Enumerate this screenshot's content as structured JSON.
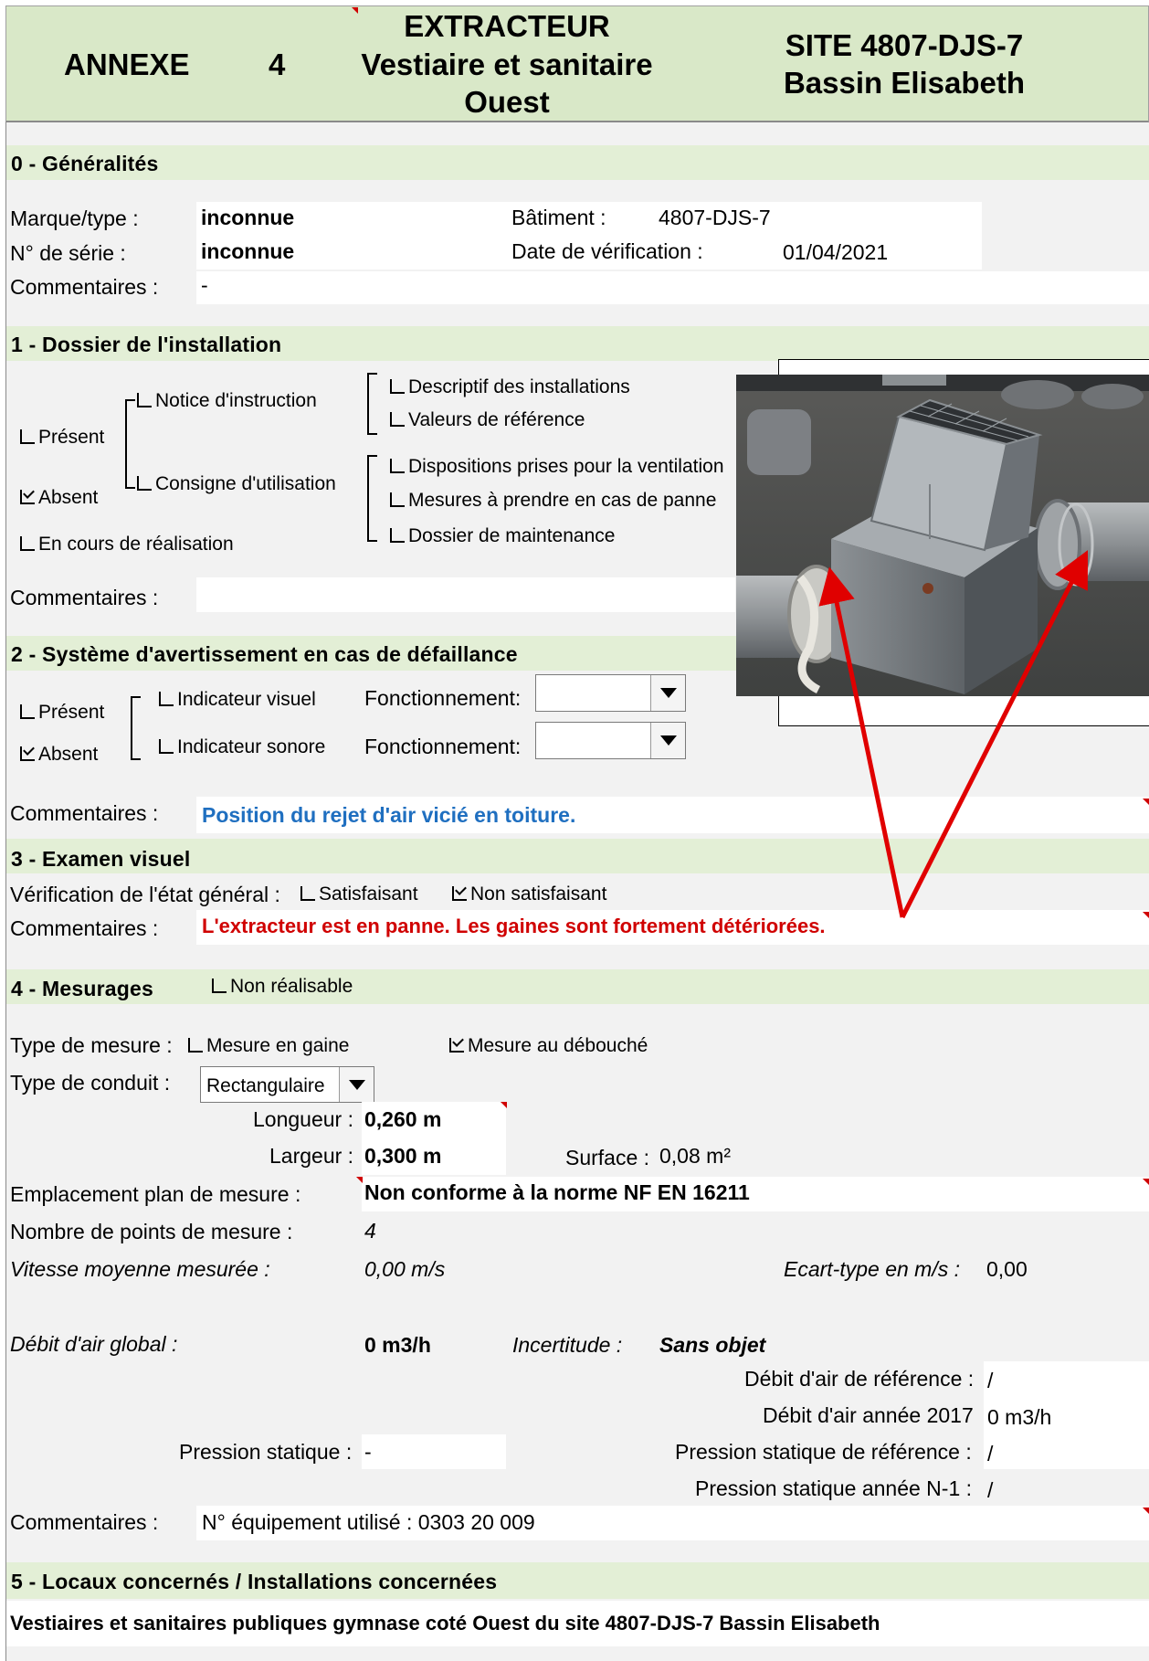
{
  "header": {
    "annexe_label": "ANNEXE",
    "annexe_number": "4",
    "title_line1": "EXTRACTEUR",
    "title_line2": "Vestiaire et sanitaire",
    "title_line3": "Ouest",
    "site_line1": "SITE 4807-DJS-7",
    "site_line2": "Bassin Elisabeth"
  },
  "s0": {
    "title": "0 - Généralités",
    "brand_label": "Marque/type :",
    "brand_value": "inconnue",
    "serial_label": "N° de série :",
    "serial_value": "inconnue",
    "comments_label": "Commentaires :",
    "comments_value": "-",
    "building_label": "Bâtiment :",
    "building_value": "4807-DJS-7",
    "date_label": "Date de vérification :",
    "date_value": "01/04/2021"
  },
  "s1": {
    "title": "1 - Dossier de l'installation",
    "present": "Présent",
    "absent": "Absent",
    "in_progress": "En cours de réalisation",
    "notice": "Notice d'instruction",
    "consigne": "Consigne d'utilisation",
    "descriptif": "Descriptif des installations",
    "valeurs": "Valeurs de référence",
    "dispositions": "Dispositions prises pour la ventilation",
    "mesures": "Mesures à prendre en cas de panne",
    "dossier": "Dossier de maintenance",
    "comments_label": "Commentaires :"
  },
  "s2": {
    "title": "2 - Système d'avertissement en cas de défaillance",
    "present": "Présent",
    "absent": "Absent",
    "visual": "Indicateur visuel",
    "sound": "Indicateur sonore",
    "func1": "Fonctionnement:",
    "func2": "Fonctionnement:",
    "comments_label": "Commentaires :",
    "comments_value": "Position du rejet d'air vicié en toiture."
  },
  "s3": {
    "title": "3 - Examen visuel",
    "check_label": "Vérification de l'état général :",
    "satisfying": "Satisfaisant",
    "not_satisfying": "Non satisfaisant",
    "comments_label": "Commentaires :",
    "comments_value": "L'extracteur est en panne. Les gaines sont fortement détériorées."
  },
  "s4": {
    "title": "4 - Mesurages",
    "not_feasible": "Non réalisable",
    "type_label": "Type de mesure :",
    "in_duct": "Mesure en gaine",
    "at_outlet": "Mesure au débouché",
    "conduit_label": "Type de conduit :",
    "conduit_value": "Rectangulaire",
    "length_label": "Longueur :",
    "length_value": "0,260 m",
    "width_label": "Largeur :",
    "width_value": "0,300 m",
    "surface_label": "Surface :",
    "surface_value": "0,08 m²",
    "location_label": "Emplacement plan de mesure :",
    "location_value": "Non conforme à la norme NF EN 16211",
    "points_label": "Nombre de points de mesure :",
    "points_value": "4",
    "speed_label": "Vitesse moyenne mesurée :",
    "speed_value": "0,00 m/s",
    "stddev_label": "Ecart-type en m/s :",
    "stddev_value": "0,00",
    "flow_label": "Débit d'air global :",
    "flow_value": "0 m3/h",
    "uncertainty_label": "Incertitude :",
    "uncertainty_value": "Sans objet",
    "ref_flow_label": "Débit d'air de référence :",
    "ref_flow_value": "/",
    "year_flow_label": "Débit d'air année 2017",
    "year_flow_value": "0 m3/h",
    "static_label": "Pression statique :",
    "static_value": "-",
    "ref_static_label": "Pression statique de référence :",
    "ref_static_value": "/",
    "prev_static_label": "Pression statique année N-1 :",
    "prev_static_value": "/",
    "comments_label": "Commentaires :",
    "comments_value": "N° équipement utilisé : 0303 20 009"
  },
  "s5": {
    "title": "5 - Locaux concernés / Installations concernées",
    "value": "Vestiaires et sanitaires publiques gymnase coté Ouest du site 4807-DJS-7  Bassin Elisabeth"
  },
  "colors": {
    "header_band": "#d9e8c8",
    "section_band": "#e3efd6",
    "blue_text": "#1f6fc0",
    "red_text": "#d00000",
    "arrow": "#e00000"
  }
}
